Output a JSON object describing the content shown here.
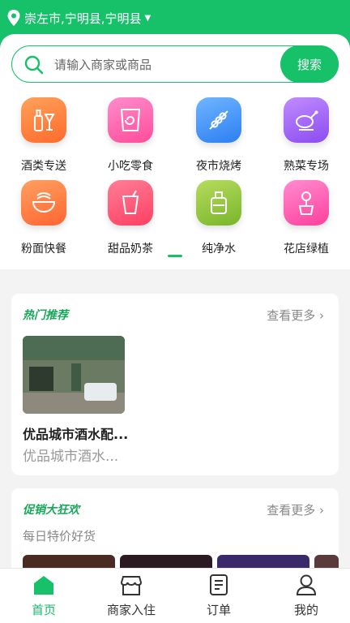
{
  "location": {
    "text": "崇左市,宁明县,宁明县"
  },
  "search": {
    "placeholder": "请输入商家或商品",
    "button": "搜索"
  },
  "categories": [
    {
      "label": "酒类专送",
      "icon": "wine-bottle-icon",
      "color": "#ff7a3d"
    },
    {
      "label": "小吃零食",
      "icon": "snack-bag-icon",
      "color": "#ff5fa8"
    },
    {
      "label": "夜市烧烤",
      "icon": "barbecue-skewer-icon",
      "color": "#3c8ff5"
    },
    {
      "label": "熟菜专场",
      "icon": "roast-chicken-icon",
      "color": "#9a5cf0"
    },
    {
      "label": "粉面快餐",
      "icon": "noodle-bowl-icon",
      "color": "#ff7b45"
    },
    {
      "label": "甜品奶茶",
      "icon": "milk-tea-icon",
      "color": "#ff4f6e"
    },
    {
      "label": "纯净水",
      "icon": "water-bucket-icon",
      "color": "#8cc43b"
    },
    {
      "label": "花店绿植",
      "icon": "flower-pot-icon",
      "color": "#ff4fa7"
    }
  ],
  "hot": {
    "title": "热门推荐",
    "more": "查看更多 ›",
    "shop": {
      "name": "优品城市酒水配...",
      "subtitle": "优品城市酒水..."
    }
  },
  "promo": {
    "title": "促销大狂欢",
    "more": "查看更多 ›",
    "subtitle": "每日特价好货"
  },
  "tabs": [
    {
      "label": "首页",
      "icon": "home-icon",
      "active": true
    },
    {
      "label": "商家入住",
      "icon": "shop-icon",
      "active": false
    },
    {
      "label": "订单",
      "icon": "order-list-icon",
      "active": false
    },
    {
      "label": "我的",
      "icon": "user-icon",
      "active": false
    }
  ],
  "colors": {
    "accent": "#17c16a"
  }
}
